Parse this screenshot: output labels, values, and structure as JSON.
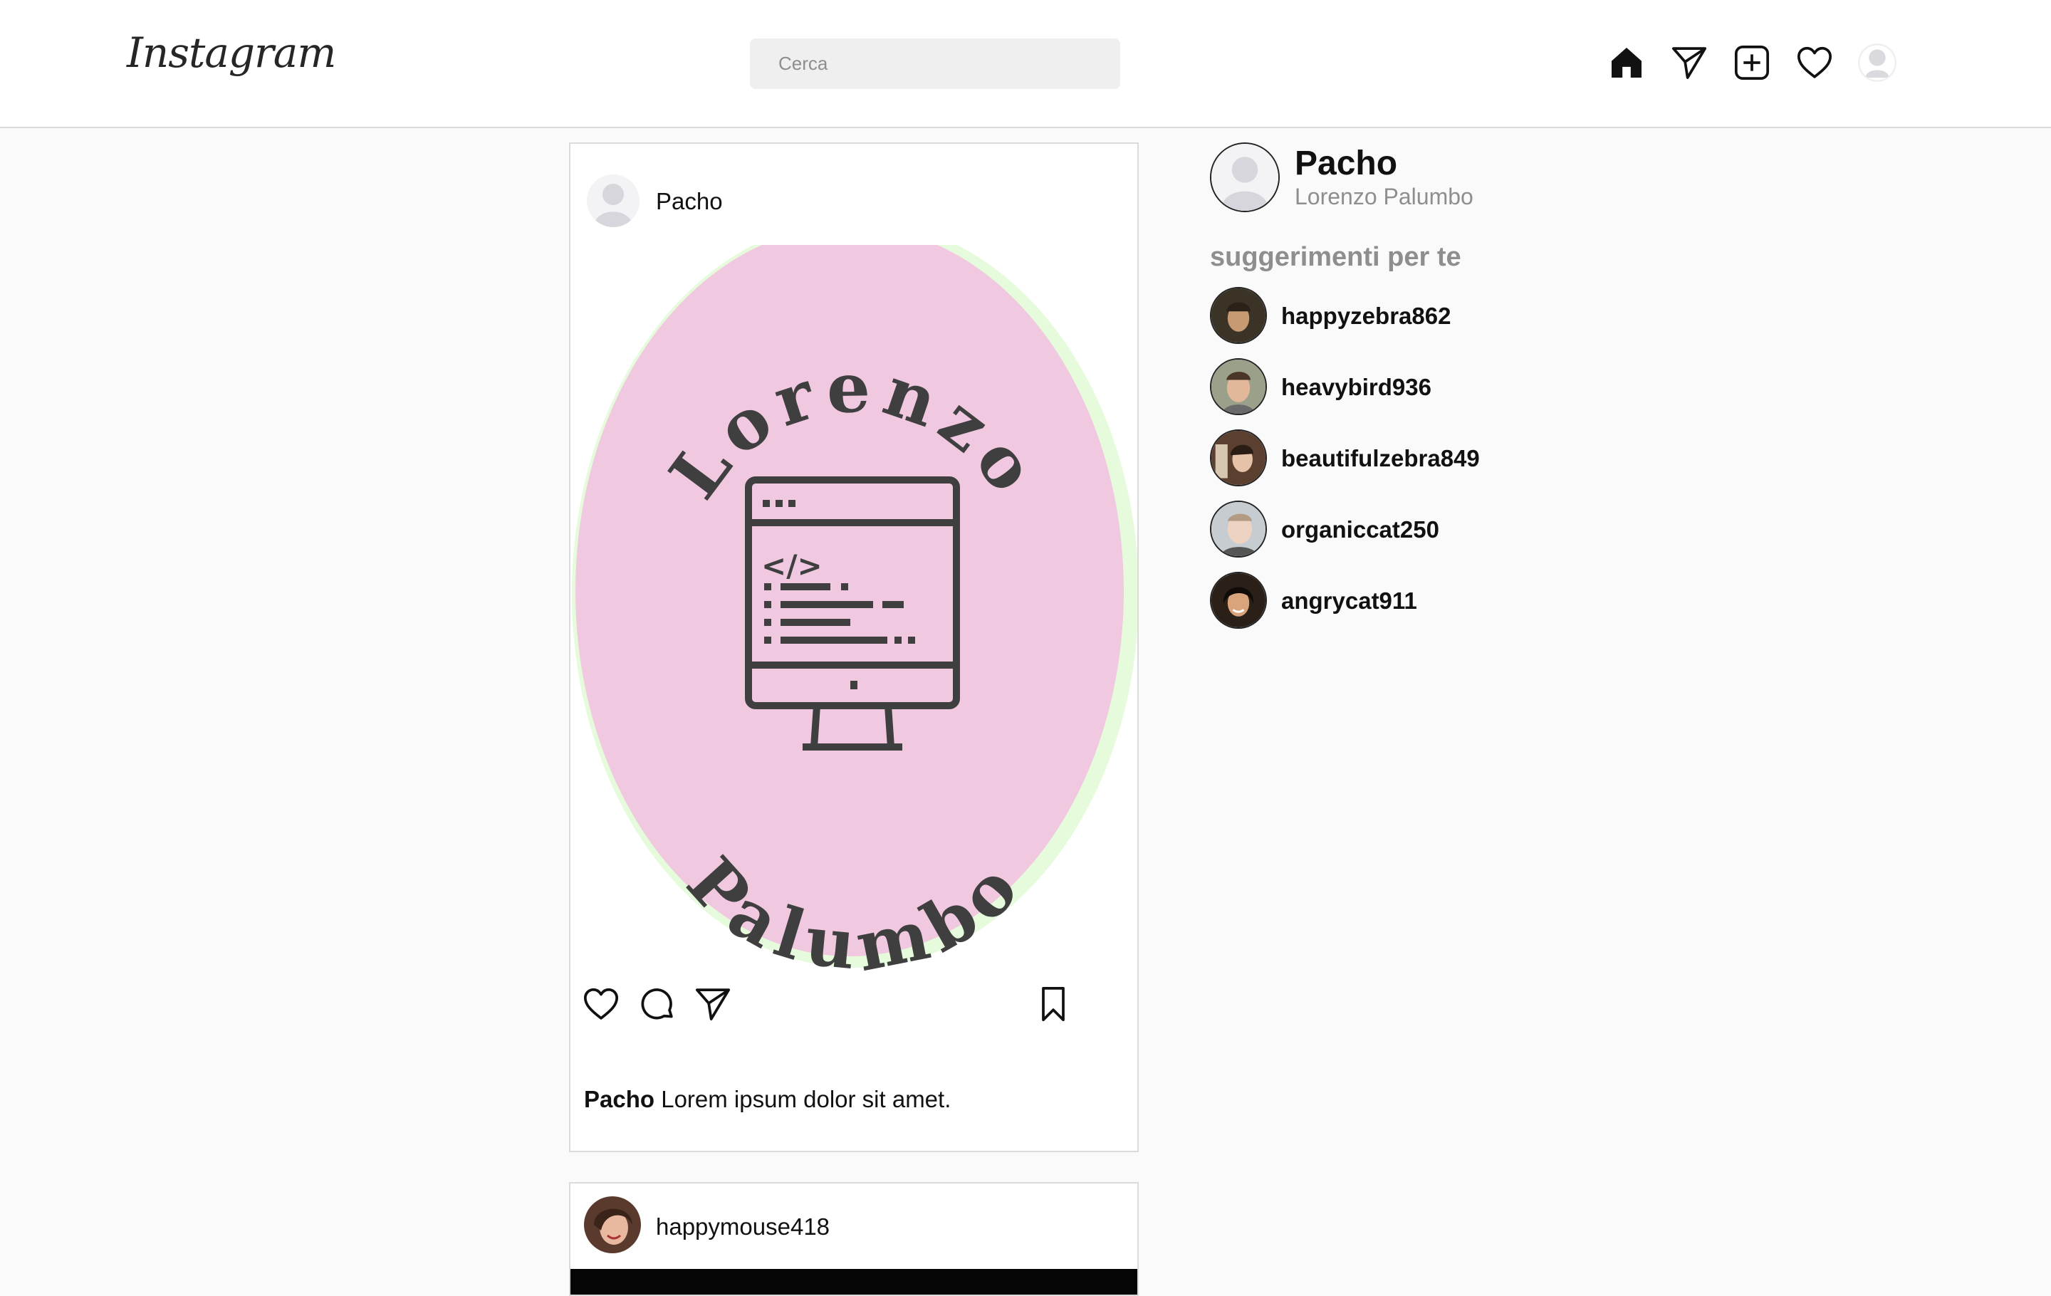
{
  "app": {
    "logo_text": "Instagram",
    "search_placeholder": "Cerca",
    "nav_icons": [
      "home-icon",
      "send-icon",
      "new-post-icon",
      "heart-icon",
      "profile-avatar"
    ]
  },
  "post": {
    "username": "Pacho",
    "image_text_top": "Lorenzo",
    "image_text_bottom": "Palumbo",
    "image_colors": {
      "oval": "#f0c9e1",
      "rim": "#e6fbdc",
      "ink": "#3f3f3f"
    },
    "caption_user": "Pacho",
    "caption_text": "Lorem ipsum dolor sit amet.",
    "actions": [
      "heart-icon",
      "comment-icon",
      "share-icon",
      "bookmark-icon"
    ]
  },
  "post2": {
    "username": "happymouse418"
  },
  "sidebar": {
    "username": "Pacho",
    "full_name": "Lorenzo Palumbo",
    "suggestions_title": "suggerimenti per te",
    "suggestions": [
      {
        "username": "happyzebra862"
      },
      {
        "username": "heavybird936"
      },
      {
        "username": "beautifulzebra849"
      },
      {
        "username": "organiccat250"
      },
      {
        "username": "angrycat911"
      }
    ]
  }
}
